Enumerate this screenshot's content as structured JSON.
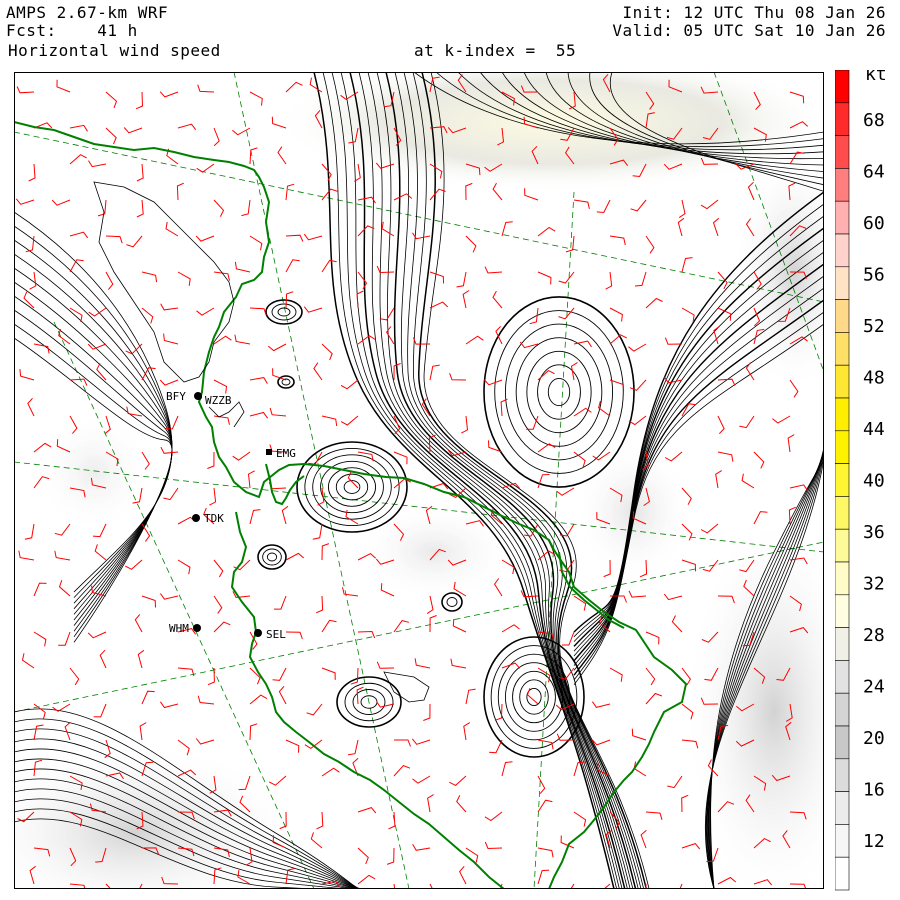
{
  "header": {
    "model": "AMPS 2.67-km WRF",
    "forecast": "Fcst:    41 h",
    "variable": "Horizontal wind speed",
    "init": "Init: 12 UTC Thu 08 Jan 26",
    "valid": "Valid: 05 UTC Sat 10 Jan 26",
    "level": "at k-index =  55"
  },
  "colorbar": {
    "unit": "kt",
    "labels": [
      "68",
      "64",
      "60",
      "56",
      "52",
      "48",
      "44",
      "40",
      "36",
      "32",
      "28",
      "24",
      "20",
      "16",
      "12"
    ],
    "colors": [
      "#ff0000",
      "#ff2a2a",
      "#ff4d4d",
      "#ff7f7f",
      "#ffb0b0",
      "#ffd2cc",
      "#ffe3c4",
      "#ffd98a",
      "#ffe066",
      "#ffe633",
      "#ffee00",
      "#fff200",
      "#fff633",
      "#fff866",
      "#fffa99",
      "#fffcc8",
      "#fffee0",
      "#f0f0e6",
      "#e2e2e2",
      "#d4d4d4",
      "#c8c8c8",
      "#dcdcdc",
      "#ececec",
      "#f6f6f6",
      "#ffffff"
    ]
  },
  "stations": [
    {
      "id": "WZZB",
      "label": "WZZB"
    },
    {
      "id": "BFY",
      "label": "BFY"
    },
    {
      "id": "TDK",
      "label": "TDK"
    },
    {
      "id": "WHM",
      "label": "WHM"
    },
    {
      "id": "SEL",
      "label": "SEL"
    },
    {
      "id": "EMG",
      "label": "EMG"
    }
  ],
  "map_colors": {
    "coastline": "#008000",
    "streamlines": "#000000",
    "barbs": "#ff0000",
    "graticule": "#008000"
  }
}
